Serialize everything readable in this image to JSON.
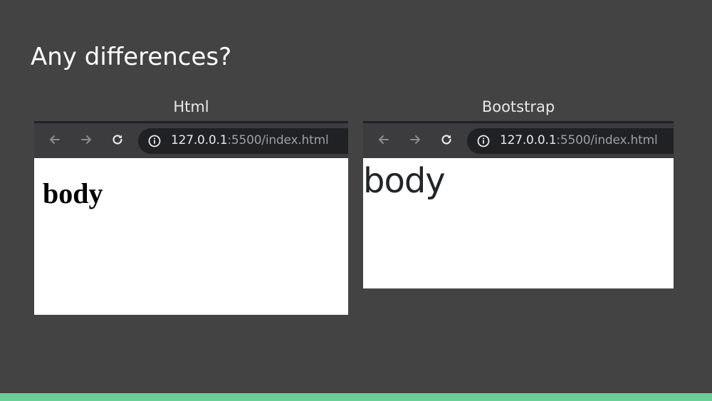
{
  "slide": {
    "title": "Any differences?",
    "accent_color": "#6ccf97",
    "background_color": "#434343"
  },
  "panels": [
    {
      "label": "Html",
      "browser": {
        "url_host": "127.0.0.1",
        "url_rest": ":5500/index.html",
        "page_text": "body"
      }
    },
    {
      "label": "Bootstrap",
      "browser": {
        "url_host": "127.0.0.1",
        "url_rest": ":5500/index.html",
        "page_text": "body"
      }
    }
  ],
  "icons": {
    "back": "back-arrow-icon",
    "forward": "forward-arrow-icon",
    "reload": "reload-icon",
    "site_info": "info-icon"
  }
}
